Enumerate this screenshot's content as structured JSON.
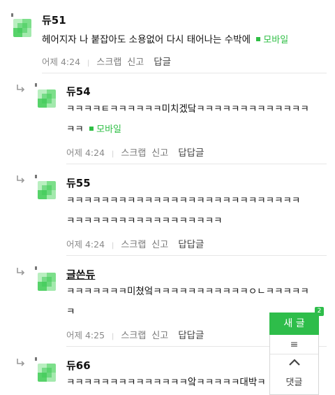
{
  "comments": [
    {
      "nick": "듀51",
      "lines": [
        "헤어지자 나 붙잡아도 소용없어 다시 태어나는 수박에"
      ],
      "mobile": "모바일",
      "time": "어제 4:24",
      "scrap": "스크랩",
      "report": "신고",
      "reply": "답글"
    },
    {
      "nick": "듀54",
      "lines": [
        "ㅋㅋㅋㅋㅌㅋㅋㅋㅋㅋㅋ미치겠닼ㅋㅋㅋㅋㅋㅋㅋㅋㅋㅋㅋㅋㅋ",
        "ㅋㅋ"
      ],
      "mobile": "모바일",
      "time": "어제 4:24",
      "scrap": "스크랩",
      "report": "신고",
      "reply": "답답글"
    },
    {
      "nick": "듀55",
      "lines": [
        "ㅋㅋㅋㅋㅋㅋㅋㅋㅋㅋㅋㅋㅋㅋㅋㅋㅋㅋㅋㅋㅋㅋㅋㅋㅋㅋㅋ",
        "ㅋㅋㅋㅋㅋㅋㅋㅋㅋㅋㅋㅋㅋㅋㅋㅋㅋㅋ"
      ],
      "time": "어제 4:24",
      "scrap": "스크랩",
      "report": "신고",
      "reply": "답답글"
    },
    {
      "nick": "글쓴듀",
      "lines": [
        "ㅋㅋㅋㅋㅋㅋㅋ미쳤엌ㅋㅋㅋㅋㅋㅋㅋㅋㅋㅋㅋㅇㄴㅋㅋㅋㅋㅋ",
        "ㅋ"
      ],
      "time": "어제 4:25",
      "scrap": "스크랩",
      "report": "신고",
      "reply": "답답글"
    },
    {
      "nick": "듀66",
      "lines": [
        "ㅋㅋㅋㅋㅋㅋㅋㅋㅋㅋㅋㅋㅋㅋ앜ㅋㅋㅋㅋㅋ대박ㅋ"
      ]
    }
  ],
  "widget": {
    "new_post": "새 글",
    "badge": "2",
    "menu_icon": "≡",
    "up_icon": "chevron-up-icon",
    "comment_label": "댓글"
  },
  "colors": {
    "accent": "#2ebd4a",
    "meta": "#8a8a8a"
  }
}
